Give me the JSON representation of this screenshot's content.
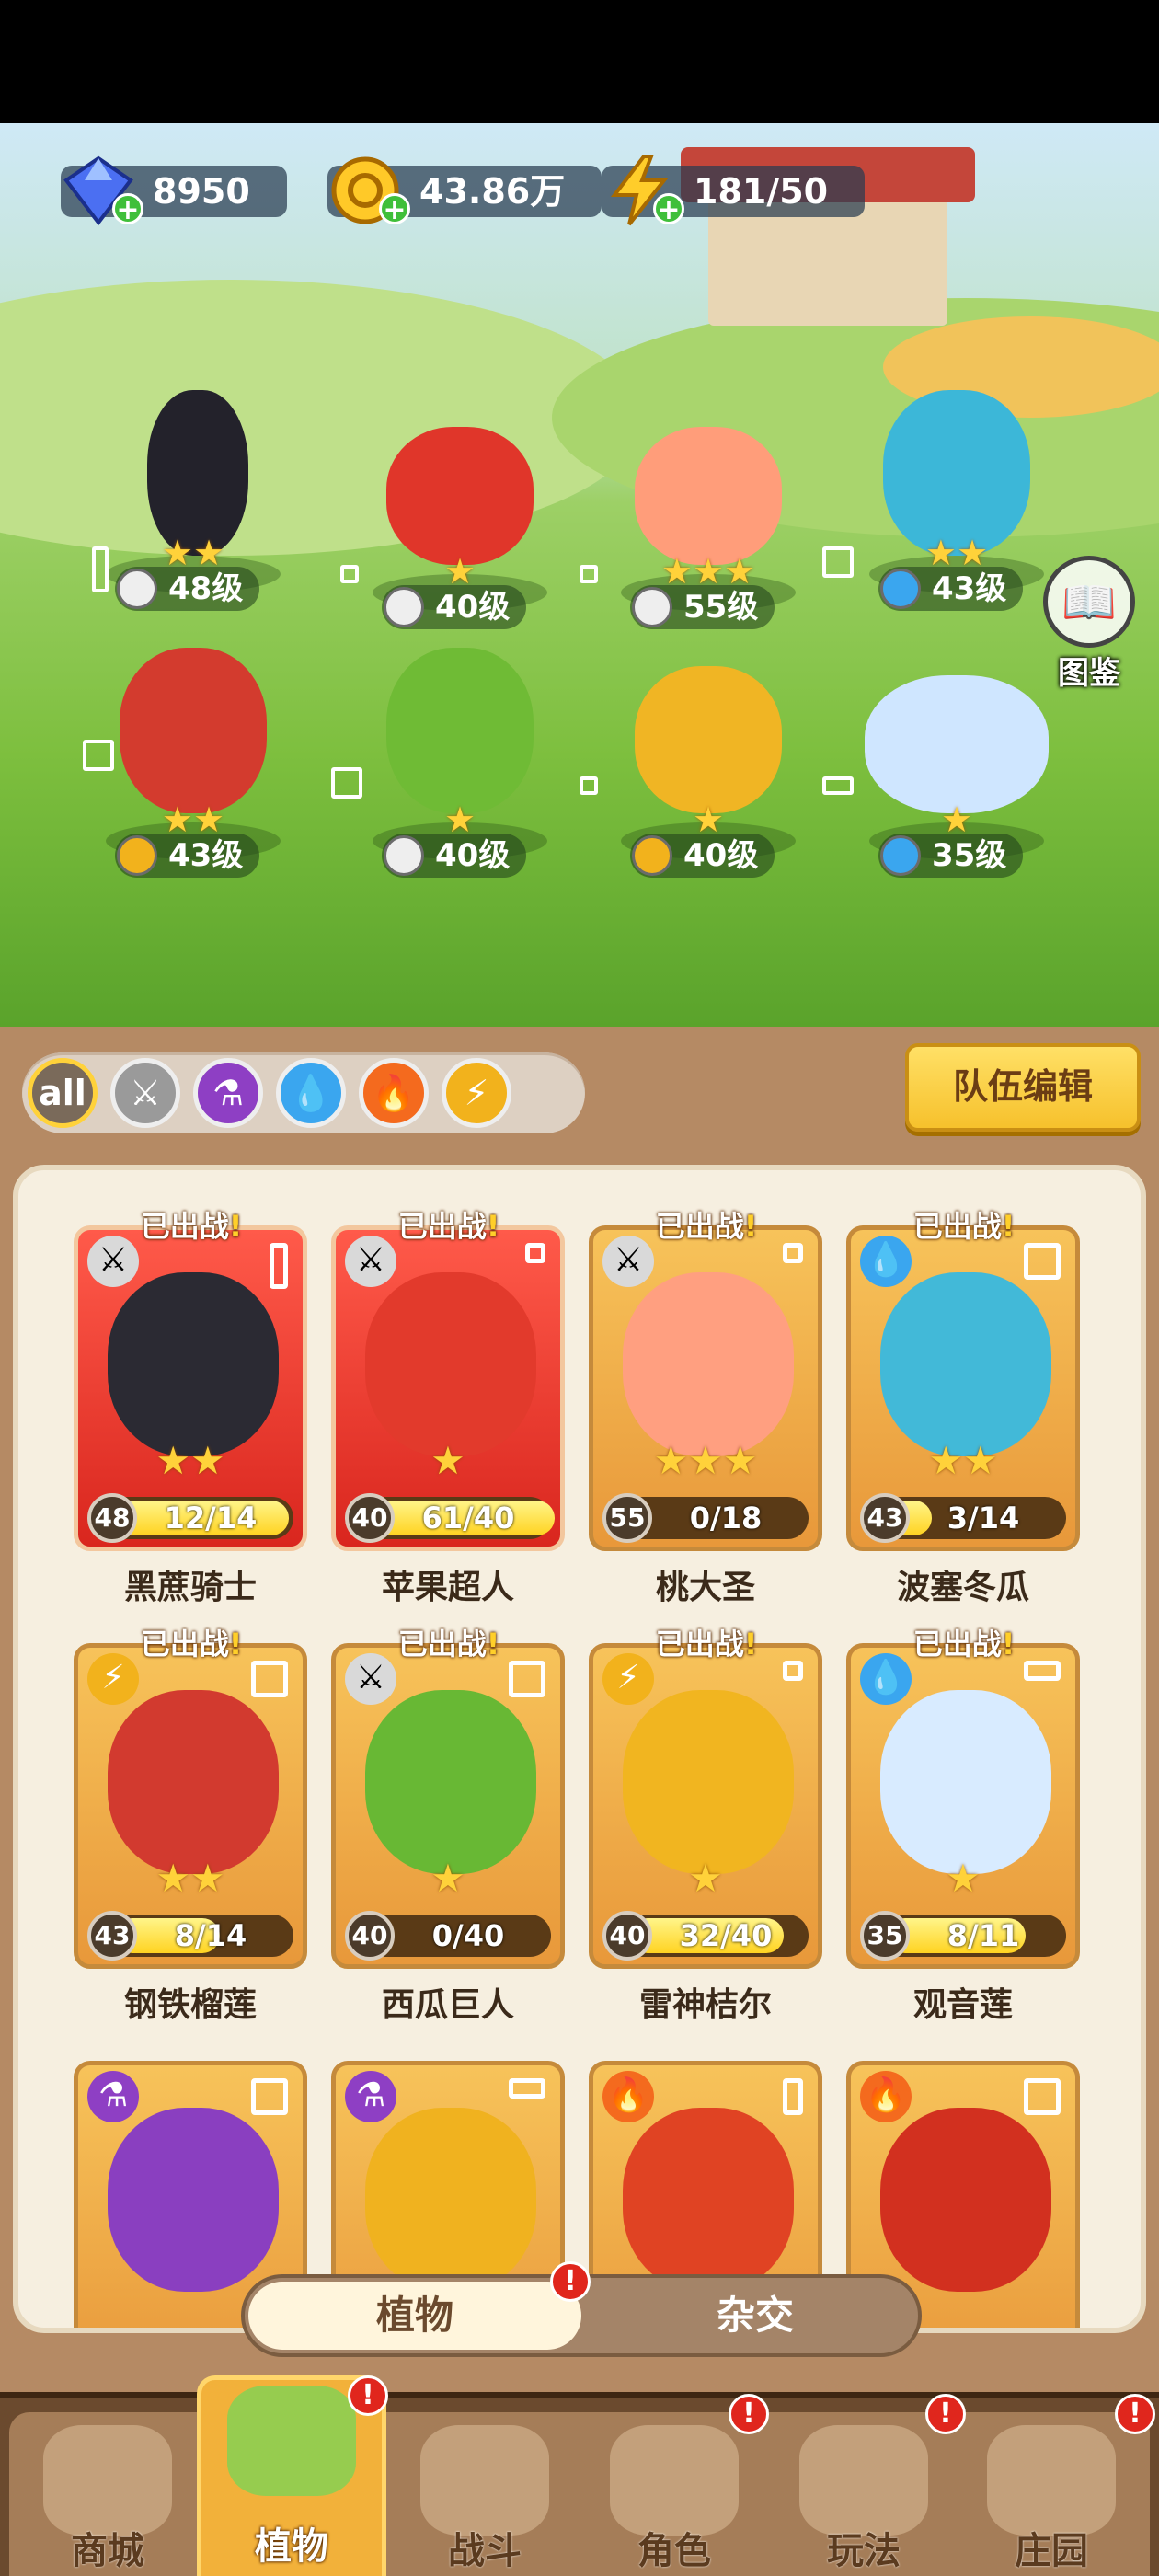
{
  "resources": {
    "gems": "8950",
    "gold": "43.86万",
    "energy": "181/50"
  },
  "dex_label": "图鉴",
  "formation": [
    {
      "level": "48级",
      "stars": "★★",
      "el": "⚔"
    },
    {
      "level": "40级",
      "stars": "★",
      "el": "⚔"
    },
    {
      "level": "55级",
      "stars": "★★★",
      "el": "⚔"
    },
    {
      "level": "43级",
      "stars": "★★",
      "el": "💧"
    },
    {
      "level": "43级",
      "stars": "★★",
      "el": "⚡"
    },
    {
      "level": "40级",
      "stars": "★",
      "el": "⚔"
    },
    {
      "level": "40级",
      "stars": "★",
      "el": "⚡"
    },
    {
      "level": "35级",
      "stars": "★",
      "el": "💧"
    }
  ],
  "filters": {
    "all": "all",
    "sword": "⚔",
    "potion": "⚗",
    "water": "💧",
    "fire": "🔥",
    "bolt": "⚡"
  },
  "team_edit": "队伍编辑",
  "deployed_tag": "已出战",
  "exclaim": "!",
  "plants": [
    {
      "name": "黑蔗骑士",
      "level": "48",
      "progress": "12/14",
      "stars": "★★",
      "el": "⚔"
    },
    {
      "name": "苹果超人",
      "level": "40",
      "progress": "61/40",
      "stars": "★",
      "el": "⚔"
    },
    {
      "name": "桃大圣",
      "level": "55",
      "progress": "0/18",
      "stars": "★★★",
      "el": "⚔"
    },
    {
      "name": "波塞冬瓜",
      "level": "43",
      "progress": "3/14",
      "stars": "★★",
      "el": "💧"
    },
    {
      "name": "钢铁榴莲",
      "level": "43",
      "progress": "8/14",
      "stars": "★★",
      "el": "⚡"
    },
    {
      "name": "西瓜巨人",
      "level": "40",
      "progress": "0/40",
      "stars": "★",
      "el": "⚔"
    },
    {
      "name": "雷神桔尔",
      "level": "40",
      "progress": "32/40",
      "stars": "★",
      "el": "⚡"
    },
    {
      "name": "观音莲",
      "level": "35",
      "progress": "8/11",
      "stars": "★",
      "el": "💧"
    }
  ],
  "more_plants_el": [
    "⚗",
    "⚗",
    "🔥",
    "🔥"
  ],
  "segment": {
    "left": "植物",
    "right": "杂交"
  },
  "nav": {
    "shop": "商城",
    "plants": "植物",
    "battle": "战斗",
    "role": "角色",
    "play": "玩法",
    "manor": "庄园"
  }
}
